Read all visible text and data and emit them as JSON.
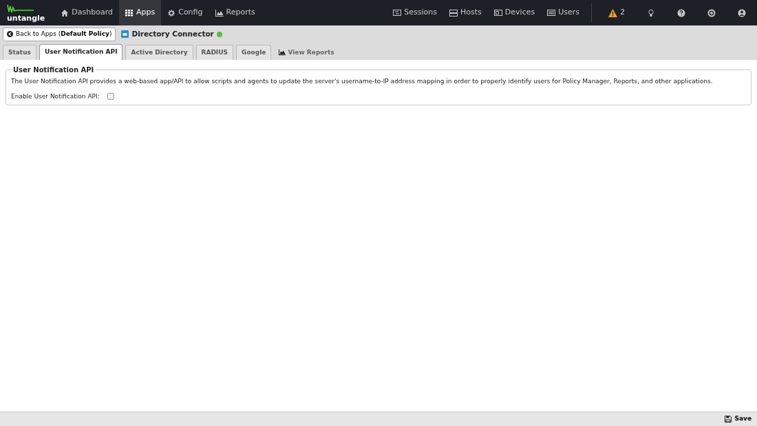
{
  "brand": {
    "name": "untangle"
  },
  "nav_left": [
    {
      "label": "Dashboard",
      "selected": false
    },
    {
      "label": "Apps",
      "selected": true
    },
    {
      "label": "Config",
      "selected": false
    },
    {
      "label": "Reports",
      "selected": false
    }
  ],
  "nav_right": [
    {
      "label": "Sessions"
    },
    {
      "label": "Hosts"
    },
    {
      "label": "Devices"
    },
    {
      "label": "Users"
    }
  ],
  "alerts": {
    "count": "2"
  },
  "back_button": {
    "label": "Back to Apps (**Default Policy**)"
  },
  "app": {
    "title": "Directory Connector",
    "running": true
  },
  "tabs": [
    {
      "label": "Status",
      "kind": "tab",
      "selected": false
    },
    {
      "label": "User Notification API",
      "kind": "tab",
      "selected": true
    },
    {
      "label": "Active Directory",
      "kind": "tab",
      "selected": false
    },
    {
      "label": "RADIUS",
      "kind": "tab",
      "selected": false
    },
    {
      "label": "Google",
      "kind": "tab",
      "selected": false
    },
    {
      "label": "View Reports",
      "kind": "link",
      "selected": false
    }
  ],
  "section": {
    "legend": "User Notification API",
    "description": "The User Notification API provides a web-based app/API to allow scripts and agents to update the server's username-to-IP address mapping in order to properly identify users for Policy Manager, Reports, and other applications.",
    "field_label": "Enable User Notification API:",
    "checked": false
  },
  "footer": {
    "save_label": "Save"
  }
}
